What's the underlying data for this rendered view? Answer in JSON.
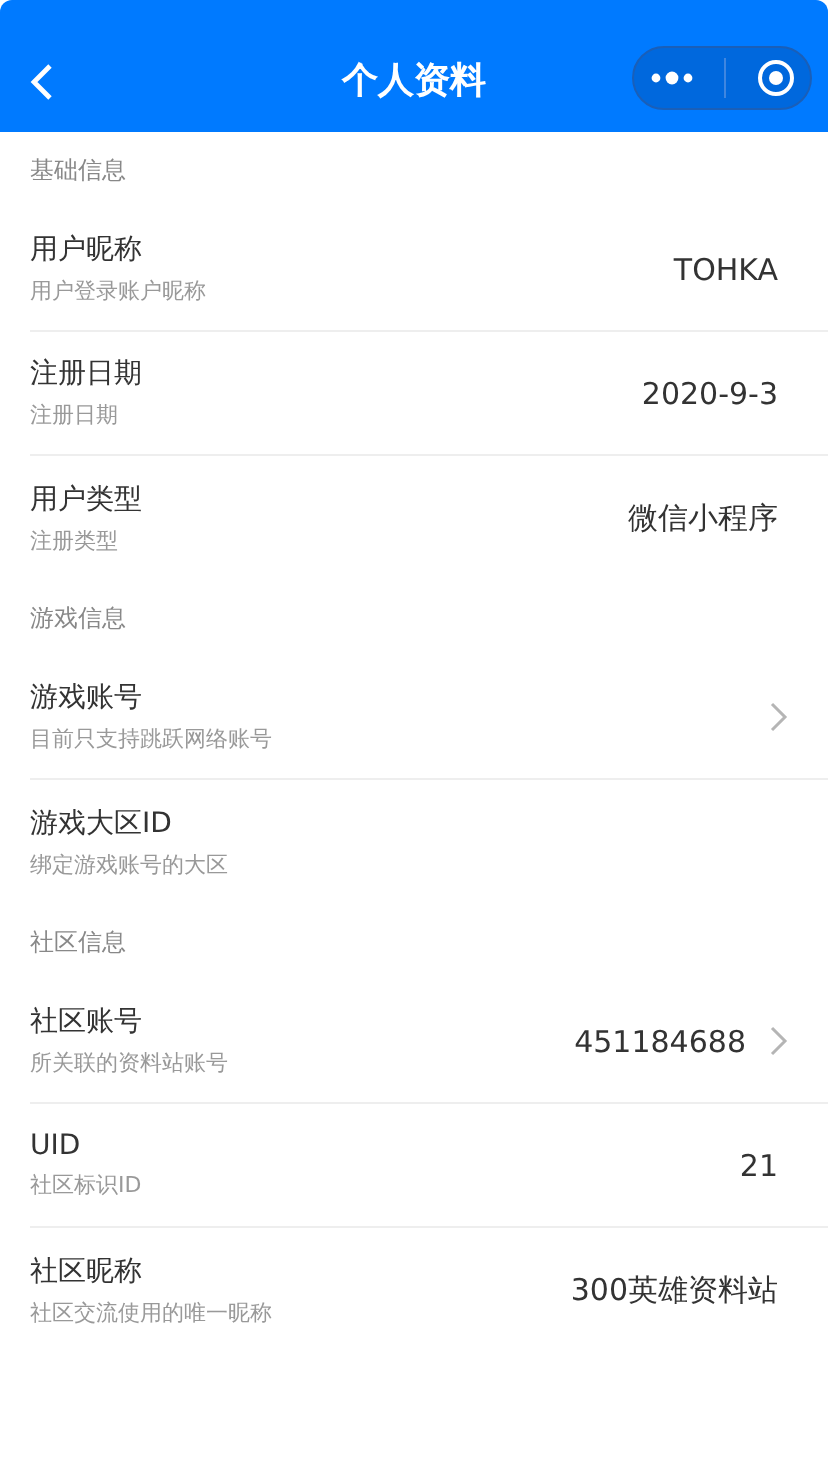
{
  "nav_bar": {
    "title": "个人资料"
  },
  "sections": [
    {
      "title": "基础信息",
      "rows": [
        {
          "label": "用户昵称",
          "hint": "用户登录账户昵称",
          "value": "TOHKA",
          "arrow": false
        },
        {
          "label": "注册日期",
          "hint": "注册日期",
          "value": "2020-9-3",
          "arrow": false
        },
        {
          "label": "用户类型",
          "hint": "注册类型",
          "value": "微信小程序",
          "arrow": false
        }
      ]
    },
    {
      "title": "游戏信息",
      "rows": [
        {
          "label": "游戏账号",
          "hint": "目前只支持跳跃网络账号",
          "arrow": true
        },
        {
          "label": "游戏大区ID",
          "hint": "绑定游戏账号的大区",
          "arrow": false
        }
      ]
    },
    {
      "title": "社区信息",
      "rows": [
        {
          "label": "社区账号",
          "hint": "所关联的资料站账号",
          "value": "451184688",
          "arrow": true
        },
        {
          "label": "UID",
          "hint": "社区标识ID",
          "value": "21",
          "arrow": false
        },
        {
          "label": "社区昵称",
          "hint": "社区交流使用的唯一昵称",
          "value": "300英雄资料站",
          "arrow": false
        }
      ]
    }
  ]
}
